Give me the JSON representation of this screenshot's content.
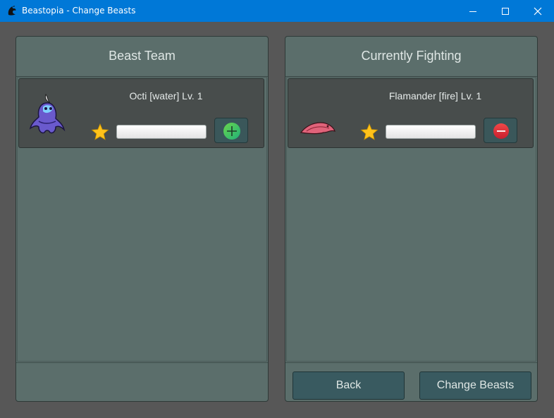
{
  "window": {
    "title": "Beastopia - Change Beasts",
    "icon": "dragon-logo-icon"
  },
  "team_panel": {
    "header": "Beast Team",
    "beasts": [
      {
        "name": "Octi [water] Lv. 1",
        "sprite": "octi-water-sprite",
        "action_icon": "plus-icon"
      }
    ]
  },
  "fighting_panel": {
    "header": "Currently Fighting",
    "beasts": [
      {
        "name": "Flamander [fire] Lv. 1",
        "sprite": "flamander-fire-sprite",
        "action_icon": "minus-icon"
      }
    ],
    "back_label": "Back",
    "change_label": "Change Beasts"
  },
  "colors": {
    "titlebar": "#0078d7",
    "panel": "#5b6e6b",
    "card": "#484d4c",
    "button": "#395a60",
    "add": "#3cc93c",
    "remove": "#e03030",
    "star": "#ffc21a"
  }
}
